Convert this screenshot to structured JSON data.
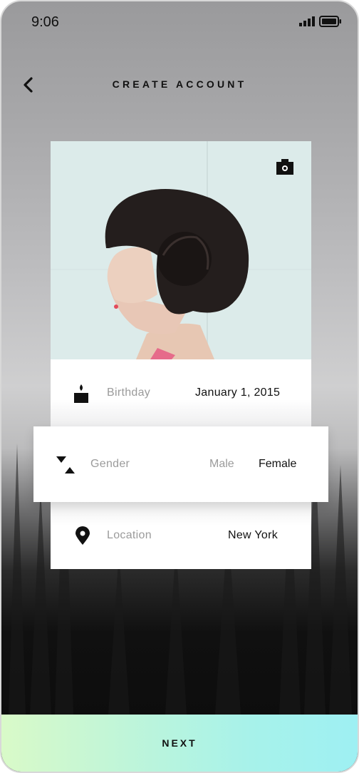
{
  "status_bar": {
    "time": "9:06",
    "signal_icon": "signal-icon",
    "battery_icon": "battery-icon"
  },
  "header": {
    "title": "CREATE ACCOUNT",
    "back_icon": "chevron-left-icon"
  },
  "profile_photo": {
    "camera_icon": "camera-icon"
  },
  "fields": {
    "birthday": {
      "icon": "candle-icon",
      "label": "Birthday",
      "value": "January 1, 2015"
    },
    "gender": {
      "icon": "hourglass-icon",
      "label": "Gender",
      "options": [
        "Male",
        "Female"
      ],
      "selected": "Female"
    },
    "location": {
      "icon": "map-pin-icon",
      "label": "Location",
      "value": "New York"
    }
  },
  "footer": {
    "next_label": "NEXT"
  },
  "colors": {
    "accent_gradient_start": "#d9fac8",
    "accent_gradient_end": "#9ef0f3",
    "muted_text": "#9b9b9b"
  }
}
